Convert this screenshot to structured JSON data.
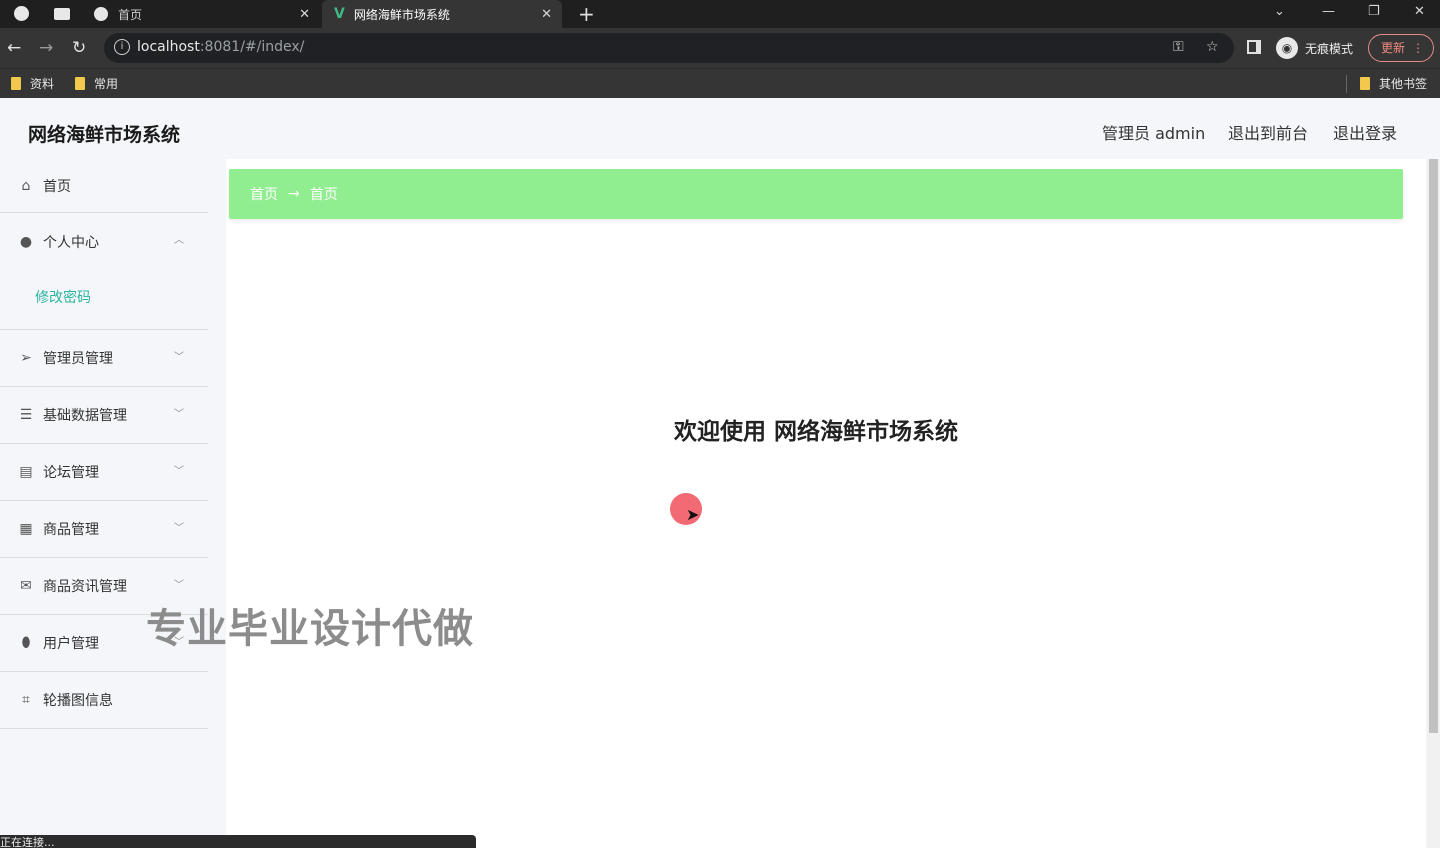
{
  "browser": {
    "tabs": [
      {
        "label": "首页",
        "icon": "globe-icon"
      },
      {
        "label": "网络海鲜市场系统",
        "icon": "vue-logo-icon"
      }
    ],
    "new_tab_symbol": "+",
    "close_symbol": "✕",
    "url_host": "localhost",
    "url_rest": ":8081/#/index/",
    "incognito_label": "无痕模式",
    "update_label": "更新",
    "bookmarks": [
      "资料",
      "常用"
    ],
    "other_bookmarks": "其他书签"
  },
  "app": {
    "title": "网络海鲜市场系统",
    "header_links": {
      "admin": "管理员 admin",
      "to_front": "退出到前台",
      "logout": "退出登录"
    },
    "sidebar": {
      "items": [
        {
          "label": "首页",
          "icon": "home-icon"
        },
        {
          "label": "个人中心",
          "icon": "user-icon",
          "expanded": true,
          "sub": [
            "修改密码"
          ]
        },
        {
          "label": "管理员管理",
          "icon": "send-icon"
        },
        {
          "label": "基础数据管理",
          "icon": "sliders-icon"
        },
        {
          "label": "论坛管理",
          "icon": "clipboard-icon"
        },
        {
          "label": "商品管理",
          "icon": "grid-icon"
        },
        {
          "label": "商品资讯管理",
          "icon": "mail-icon"
        },
        {
          "label": "用户管理",
          "icon": "shield-icon"
        },
        {
          "label": "轮播图信息",
          "icon": "crop-icon"
        }
      ]
    },
    "breadcrumb": [
      "首页",
      "首页"
    ],
    "breadcrumb_arrow": "→",
    "welcome": "欢迎使用 网络海鲜市场系统"
  },
  "overlay": {
    "watermark": "专业毕业设计代做",
    "status": "正在连接..."
  },
  "colors": {
    "breadcrumb_bg": "#90ee90",
    "submenu_active": "#2cb5a0",
    "cursor_highlight": "#f0505a"
  }
}
